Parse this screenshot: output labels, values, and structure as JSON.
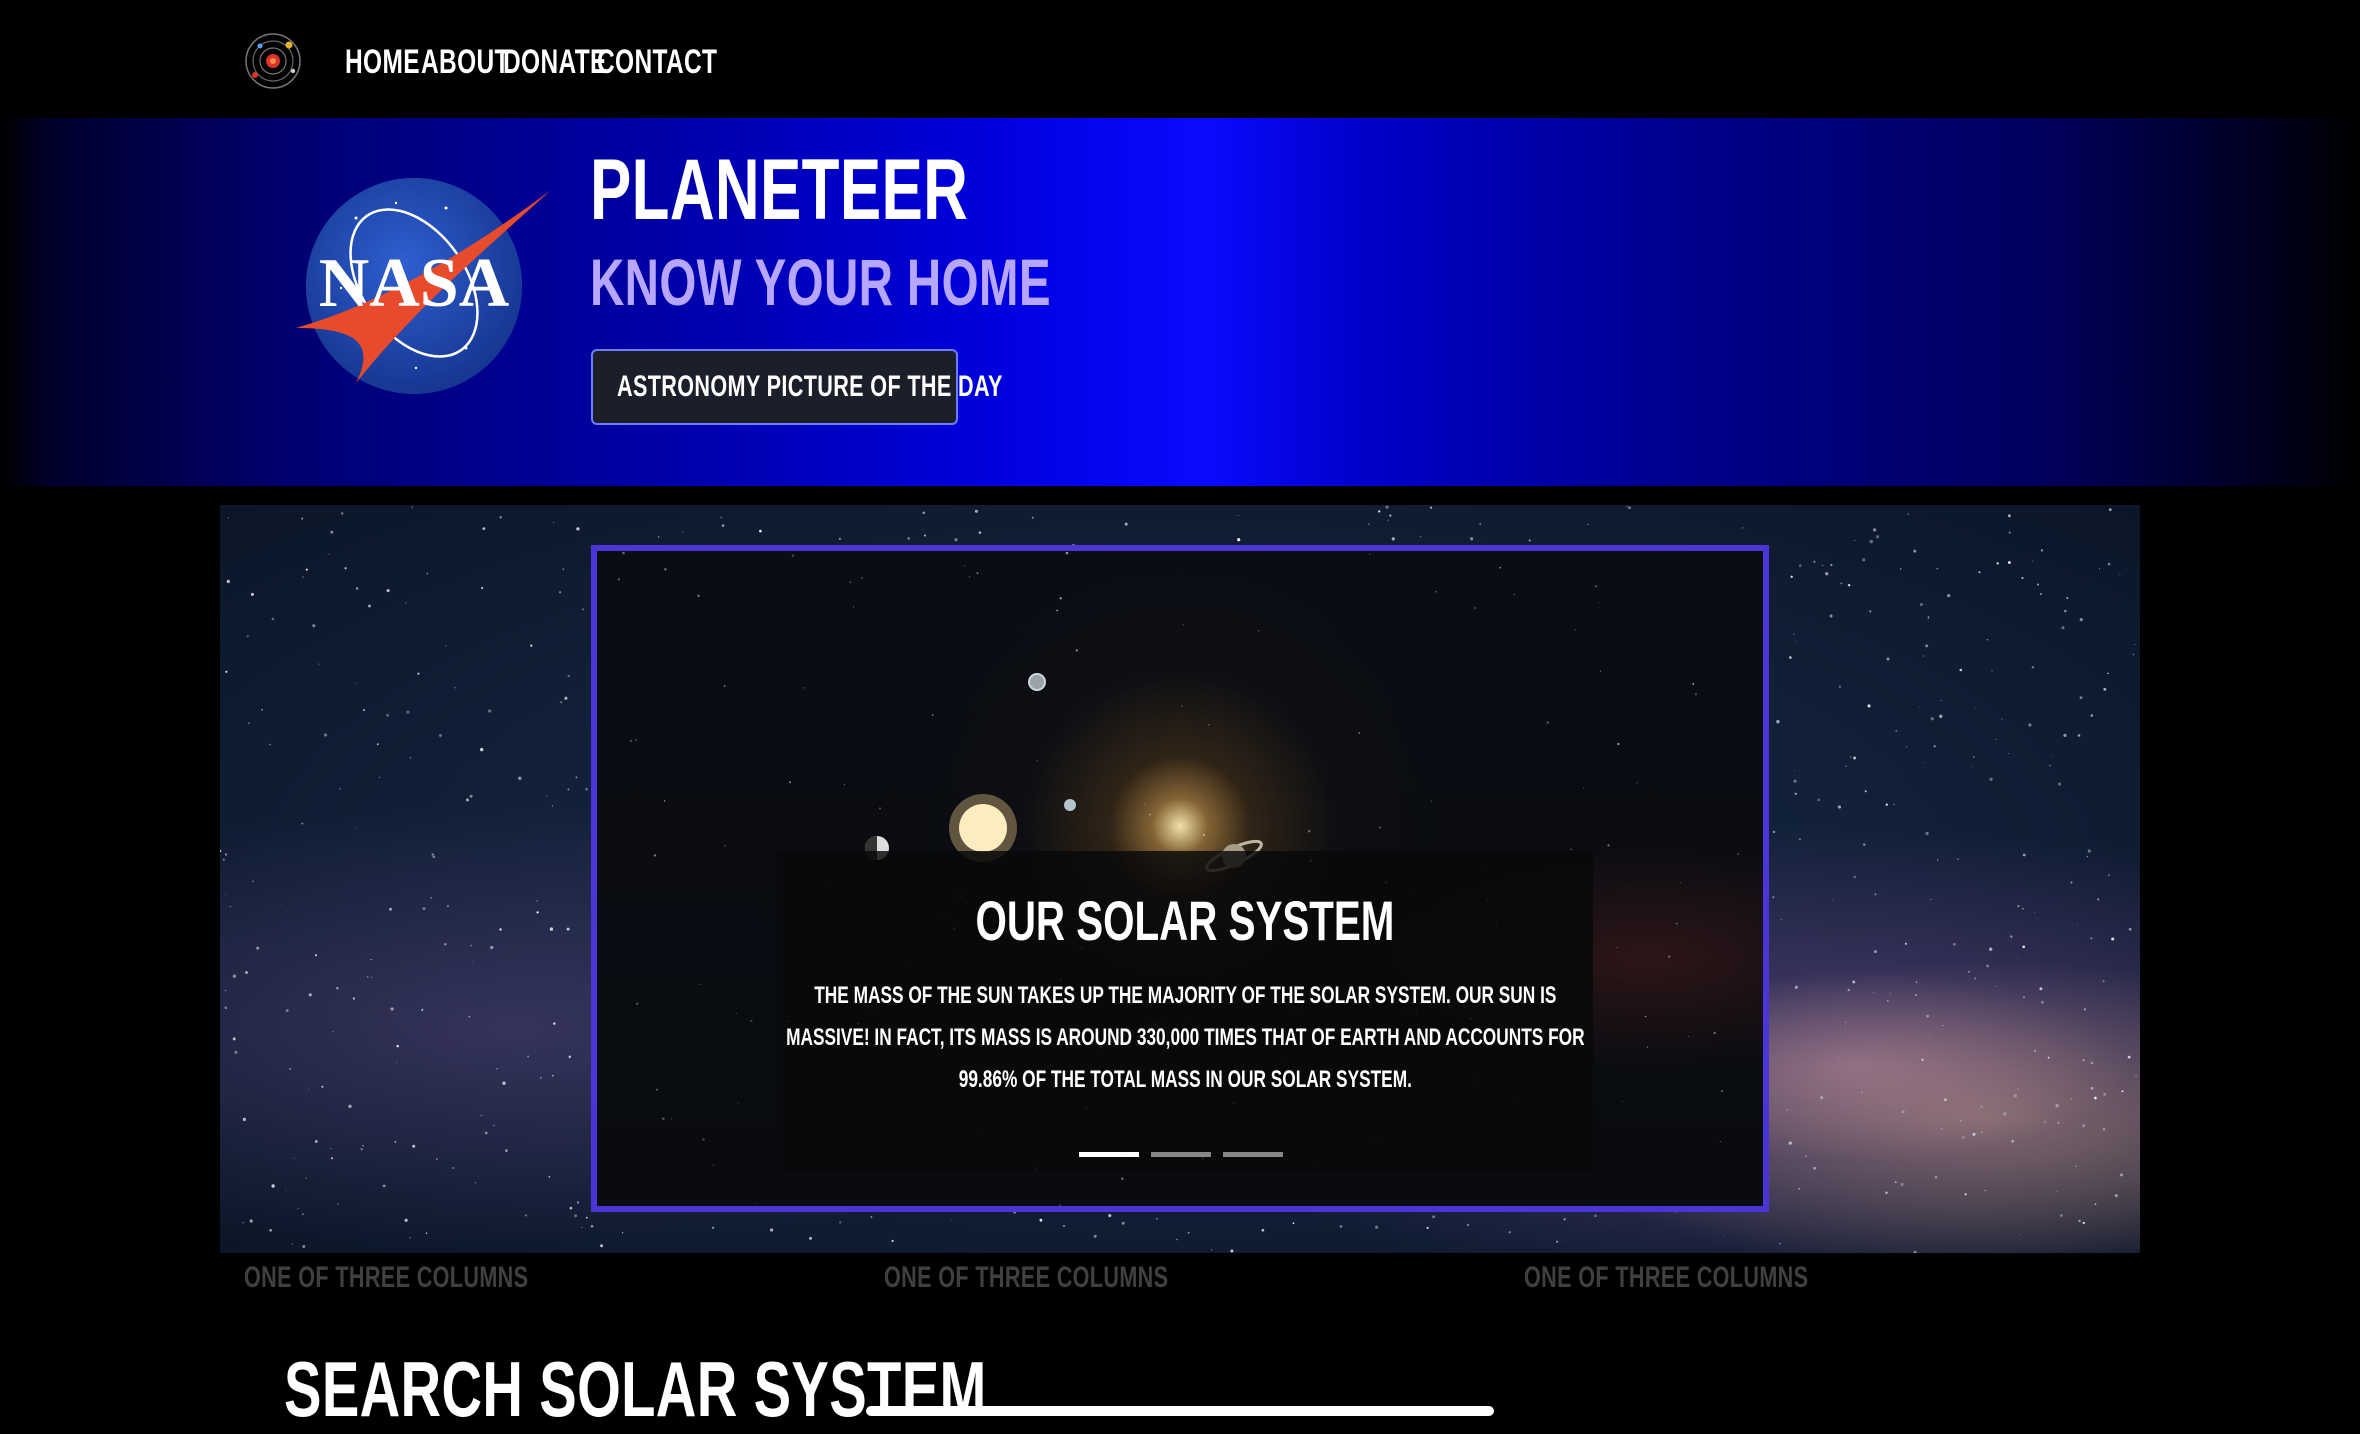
{
  "navbar": {
    "logo_icon": "solar-system-icon",
    "links": [
      "HOME",
      "ABOUT",
      "DONATE",
      "CONTACT"
    ]
  },
  "hero": {
    "logo_text": "NASA",
    "title": "PLANETEER",
    "subtitle": "KNOW YOUR HOME",
    "button_label": "ASTRONOMY PICTURE OF THE DAY"
  },
  "carousel": {
    "active_slide": 1,
    "slide_count": 3,
    "caption": {
      "title": "OUR SOLAR SYSTEM",
      "text": "THE MASS OF THE SUN TAKES UP THE MAJORITY OF THE SOLAR SYSTEM. OUR SUN IS MASSIVE! IN FACT, ITS MASS IS AROUND 330,000 TIMES THAT OF EARTH AND ACCOUNTS FOR 99.86% OF THE TOTAL MASS IN OUR SOLAR SYSTEM."
    },
    "border_color": "#4b35d6"
  },
  "columns": [
    "ONE OF THREE COLUMNS",
    "ONE OF THREE COLUMNS",
    "ONE OF THREE COLUMNS"
  ],
  "search": {
    "heading": "SEARCH SOLAR SYSTEM",
    "value": ""
  },
  "colors": {
    "hero_center": "#0a0aff",
    "subtitle": "#b7a6ff",
    "button_border": "#6a7fff"
  }
}
